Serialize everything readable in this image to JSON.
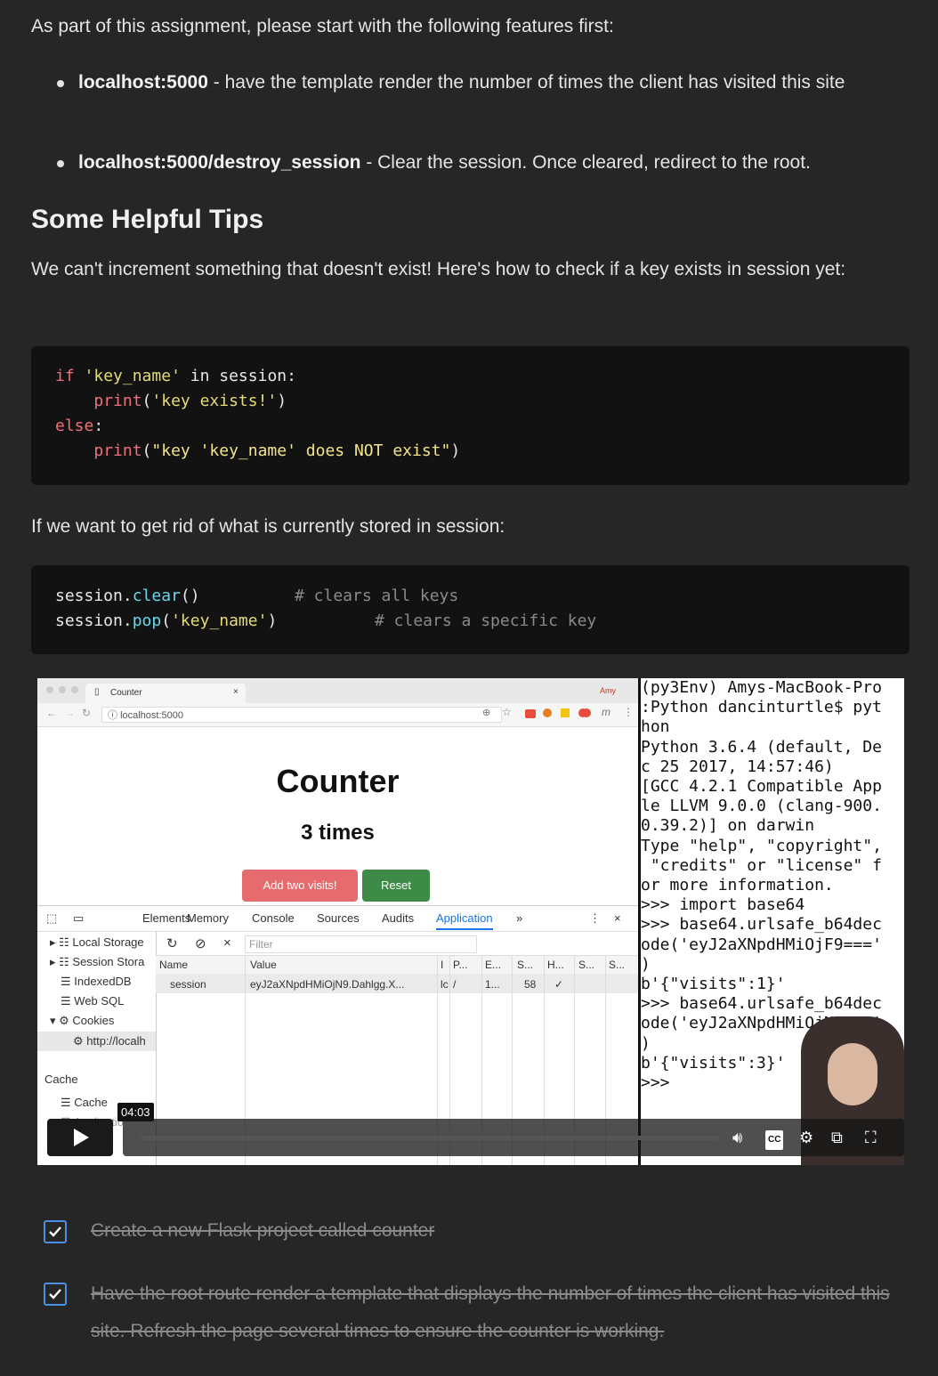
{
  "intro": "As part of this assignment, please start with the following features first:",
  "features": [
    {
      "route": "localhost:5000",
      "desc": " - have the template render the number of times the client has visited this site"
    },
    {
      "route": "localhost:5000/destroy_session",
      "desc": " - Clear the session. Once cleared, redirect to the root."
    }
  ],
  "tips_heading": "Some Helpful Tips",
  "tips_text": "We can't increment something that doesn't exist! Here's how to check if a key exists in session yet:",
  "code1": {
    "l1_kw": "if",
    "l1_str": "'key_name'",
    "l1_rest": " in session:",
    "l2_fn": "print",
    "l2_str": "'key exists!'",
    "l3_kw": "else",
    "l4_fn": "print",
    "l4_str": "\"key 'key_name' does NOT exist\""
  },
  "clear_text": "If we want to get rid of what is currently stored in session:",
  "code2": {
    "l1_obj": "session.",
    "l1_m": "clear",
    "l1_args": "()",
    "l1_cm": "# clears all keys",
    "l2_obj": "session.",
    "l2_m": "pop",
    "l2_str": "'key_name'",
    "l2_cm": "# clears a specific key"
  },
  "video": {
    "tab_title": "Counter",
    "profile": "Amy",
    "url": "localhost:5000",
    "page_heading": "Counter",
    "page_count": "3 times",
    "btn_add": "Add two visits!",
    "btn_reset": "Reset",
    "devtools_tabs": [
      "Elements",
      "Memory",
      "Console",
      "Sources",
      "Audits",
      "Application"
    ],
    "sidebar": [
      "Local Storage",
      "Session Stora",
      "IndexedDB",
      "Web SQL",
      "Cookies",
      "http://localh",
      "Cache",
      "Cache",
      "Applicatio"
    ],
    "filter": "Filter",
    "columns": [
      "Name",
      "Value",
      "I",
      "P...",
      "E...",
      "S...",
      "H...",
      "S...",
      "S..."
    ],
    "row": [
      "session",
      "eyJ2aXNpdHMiOjN9.Dahlgg.X...",
      "lc",
      "/",
      "1...",
      "58",
      "✓"
    ],
    "terminal": "(py3Env) Amys-MacBook-Pro\n:Python dancinturtle$ pyt\nhon\nPython 3.6.4 (default, De\nc 25 2017, 14:57:46)\n[GCC 4.2.1 Compatible App\nle LLVM 9.0.0 (clang-900.\n0.39.2)] on darwin\nType \"help\", \"copyright\",\n \"credits\" or \"license\" f\nor more information.\n>>> import base64\n>>> base64.urlsafe_b64dec\node('eyJ2aXNpdHMiOjF9==='\n)\nb'{\"visits\":1}'\n>>> base64.urlsafe_b64dec\node('eyJ2aXNpdHMiOjN9==='\n)\nb'{\"visits\":3}'\n>>> ",
    "timestamp": "04:03",
    "cc": "CC"
  },
  "tasks": [
    "Create a new Flask project called counter",
    "Have the root route render a template that displays the number of times the client has visited this site. Refresh the page several times to ensure the counter is working."
  ]
}
